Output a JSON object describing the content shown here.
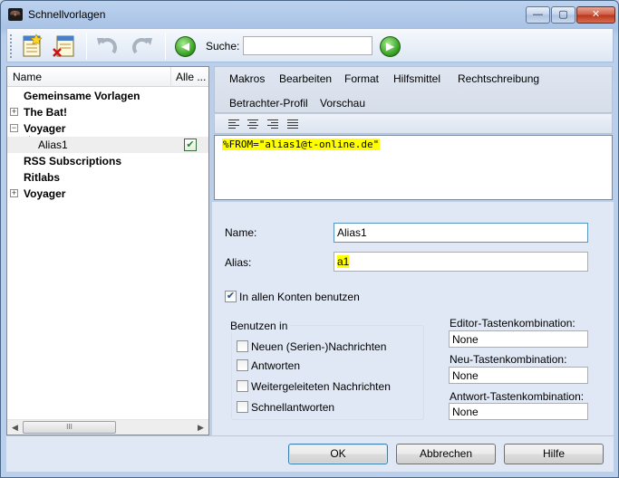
{
  "window": {
    "title": "Schnellvorlagen",
    "app_icon_glyph": "🦇",
    "minimize_glyph": "—",
    "maximize_glyph": "▢",
    "close_glyph": "✕"
  },
  "toolbar": {
    "search_label": "Suche:",
    "search_value": "",
    "back_glyph": "◀",
    "forward_glyph": "▶"
  },
  "tree": {
    "columns": [
      "Name",
      "Alle ..."
    ],
    "rows": [
      {
        "label": "Gemeinsame Vorlagen",
        "bold": true,
        "expander": ""
      },
      {
        "label": "The Bat!",
        "bold": true,
        "expander": "+"
      },
      {
        "label": "Voyager",
        "bold": true,
        "expander": "−"
      },
      {
        "label": "Alias1",
        "bold": false,
        "expander": "",
        "checked": true
      },
      {
        "label": "RSS Subscriptions",
        "bold": true,
        "expander": ""
      },
      {
        "label": "Ritlabs",
        "bold": true,
        "expander": ""
      },
      {
        "label": "Voyager",
        "bold": true,
        "expander": "+"
      }
    ],
    "scroll_left_glyph": "◀",
    "scroll_right_glyph": "▶",
    "scroll_thumb_glyph": "III",
    "check_glyph": "✔"
  },
  "editor": {
    "menu": [
      "Makros",
      "Bearbeiten",
      "Format",
      "Hilfsmittel",
      "Rechtschreibung",
      "Betrachter-Profil",
      "Vorschau"
    ],
    "content": "%FROM=\"alias1@t-online.de\""
  },
  "props": {
    "name_label": "Name:",
    "name_value": "Alias1",
    "alias_label": "Alias:",
    "alias_value": "a1",
    "all_accounts_label": "In allen Konten benutzen",
    "all_accounts_checked": true,
    "use_in_title": "Benutzen in",
    "use_in_options": [
      {
        "label": "Neuen (Serien-)Nachrichten",
        "checked": false
      },
      {
        "label": "Antworten",
        "checked": false
      },
      {
        "label": "Weitergeleiteten Nachrichten",
        "checked": false
      },
      {
        "label": "Schnellantworten",
        "checked": false
      }
    ],
    "editor_shortcut_label": "Editor-Tastenkombination:",
    "editor_shortcut_value": "None",
    "new_shortcut_label": "Neu-Tastenkombination:",
    "new_shortcut_value": "None",
    "reply_shortcut_label": "Antwort-Tastenkombination:",
    "reply_shortcut_value": "None",
    "check_glyph": "✔"
  },
  "buttons": {
    "ok": "OK",
    "cancel": "Abbrechen",
    "help": "Hilfe"
  }
}
